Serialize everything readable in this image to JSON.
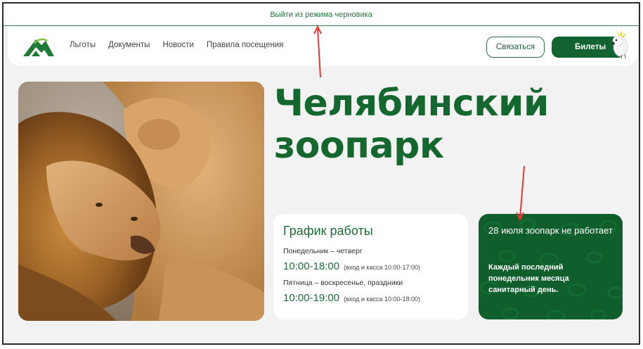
{
  "draft_banner": {
    "label": "Выйти из режима черновика"
  },
  "header": {
    "nav": [
      {
        "label": "Льготы"
      },
      {
        "label": "Документы"
      },
      {
        "label": "Новости"
      },
      {
        "label": "Правила посещения"
      }
    ],
    "contact_label": "Связаться",
    "tickets_label": "Билеты"
  },
  "hero": {
    "title_line1": "Челябинский",
    "title_line2": "зоопарк"
  },
  "schedule": {
    "title": "График работы",
    "rows": [
      {
        "days": "Понедельник – четверг",
        "time": "10:00-18:00",
        "note": "(вход и касса 10:00-17:00)"
      },
      {
        "days": "Пятница – воскресенье, праздники",
        "time": "10:00-19:00",
        "note": "(вход и касса 10:00-18:00)"
      }
    ]
  },
  "notice": {
    "heading": "28 июля зоопарк не работает",
    "text": "Каждый последний понедельник месяца санитарный день."
  },
  "colors": {
    "brand_green": "#12632f",
    "title_green": "#14672f",
    "annotation_red": "#e53935"
  }
}
